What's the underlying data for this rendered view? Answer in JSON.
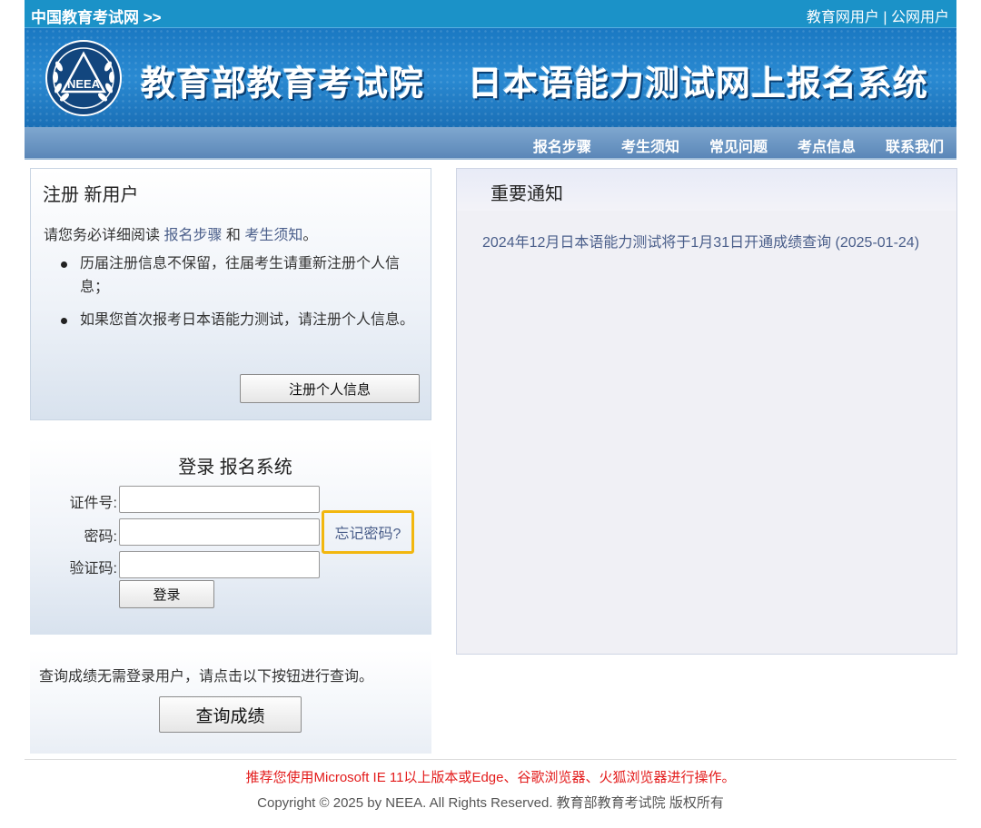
{
  "topbar": {
    "site_link": "中国教育考试网 >>",
    "user_edu": "教育网用户",
    "separator": "|",
    "user_public": "公网用户"
  },
  "banner": {
    "logo_text": "NEEA",
    "title_org": "教育部教育考试院",
    "title_system": "日本语能力测试网上报名系统"
  },
  "nav": {
    "items": [
      "报名步骤",
      "考生须知",
      "常见问题",
      "考点信息",
      "联系我们"
    ]
  },
  "register": {
    "title": "注册 新用户",
    "intro_prefix": "请您务必详细阅读 ",
    "link_steps": "报名步骤",
    "intro_and": " 和 ",
    "link_notice": "考生须知",
    "intro_suffix": "。",
    "bullets": [
      "历届注册信息不保留，往届考生请重新注册个人信息；",
      "如果您首次报考日本语能力测试，请注册个人信息。"
    ],
    "button": "注册个人信息"
  },
  "login": {
    "title": "登录 报名系统",
    "id_label": "证件号:",
    "id_value": "",
    "password_label": "密码:",
    "password_value": "",
    "captcha_label": "验证码:",
    "captcha_value": "",
    "forgot": "忘记密码?",
    "button": "登录"
  },
  "query": {
    "text": "查询成绩无需登录用户，请点击以下按钮进行查询。",
    "button": "查询成绩"
  },
  "notice": {
    "title": "重要通知",
    "items": [
      "2024年12月日本语能力测试将于1月31日开通成绩查询 (2025-01-24)"
    ]
  },
  "footer": {
    "browser_tip": "推荐您使用Microsoft IE 11以上版本或Edge、谷歌浏览器、火狐浏览器进行操作。",
    "copyright": "Copyright © 2025 by NEEA. All Rights Reserved. 教育部教育考试院 版权所有"
  },
  "colors": {
    "topbar": "#1b92c8",
    "banner": "#1a78c2",
    "nav": "#5b87b8",
    "link": "#4a5e8a",
    "highlight": "#f2b70f",
    "warning": "#e31b1b"
  }
}
